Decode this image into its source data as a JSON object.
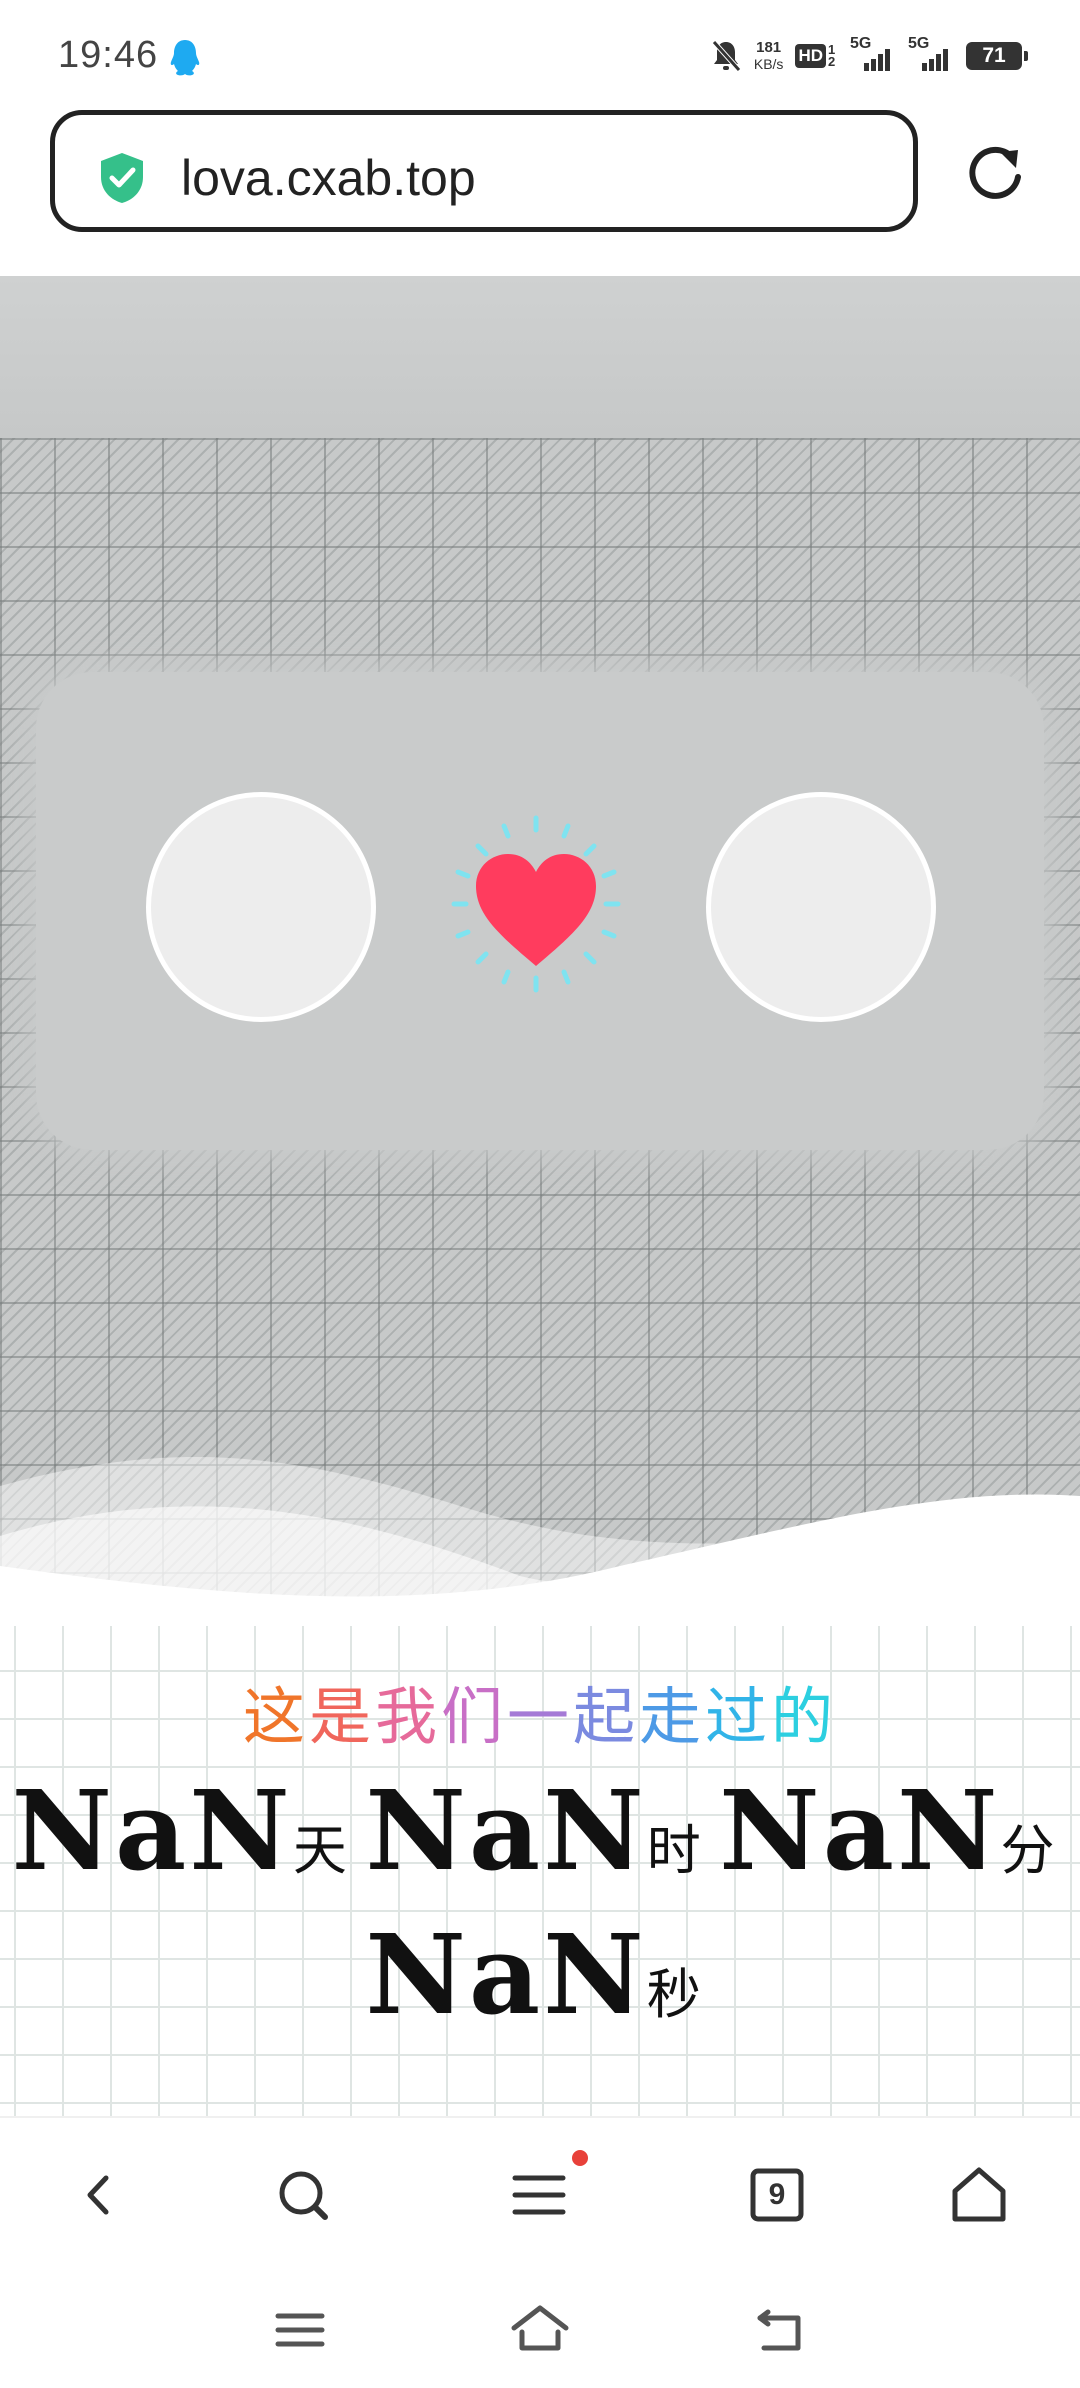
{
  "status_bar": {
    "time": "19:46",
    "net_speed_value": "181",
    "net_speed_unit": "KB/s",
    "hd_label": "HD",
    "hd_sub": "1 2",
    "signal1_label": "5G",
    "signal2_label": "5G",
    "battery_level": "71",
    "icons": [
      "qq-notification-icon",
      "mute-bell-icon",
      "hd-icon",
      "signal-icon",
      "battery-icon"
    ]
  },
  "browser": {
    "url": "lova.cxab.top",
    "secure_icon": "shield-check-icon",
    "reload_icon": "reload-icon"
  },
  "love_card": {
    "left_avatar": "avatar-left",
    "right_avatar": "avatar-right",
    "heart_icon": "heart-icon",
    "heart_color": "#ff3c5e",
    "spark_color": "#7fe3f0"
  },
  "counter": {
    "subtitle_chars": [
      "这",
      "是",
      "我",
      "们",
      "一",
      "起",
      "走",
      "过",
      "的"
    ],
    "subtitle_colors": [
      "#f0752a",
      "#f0665c",
      "#e66a9a",
      "#c86fc6",
      "#a57ad6",
      "#7b8ae0",
      "#4d9ae6",
      "#31b4e8",
      "#2ccfe0"
    ],
    "days_value": "NaN",
    "days_unit": "天",
    "hours_value": "NaN",
    "hours_unit": "时",
    "minutes_value": "NaN",
    "minutes_unit": "分",
    "seconds_value": "NaN",
    "seconds_unit": "秒"
  },
  "browser_nav": {
    "tabs_count": "9",
    "icons": [
      "back-icon",
      "search-icon",
      "menu-icon",
      "tabs-icon",
      "home-icon"
    ]
  },
  "system_nav": {
    "icons": [
      "recent-apps-icon",
      "home-icon",
      "back-icon"
    ]
  }
}
